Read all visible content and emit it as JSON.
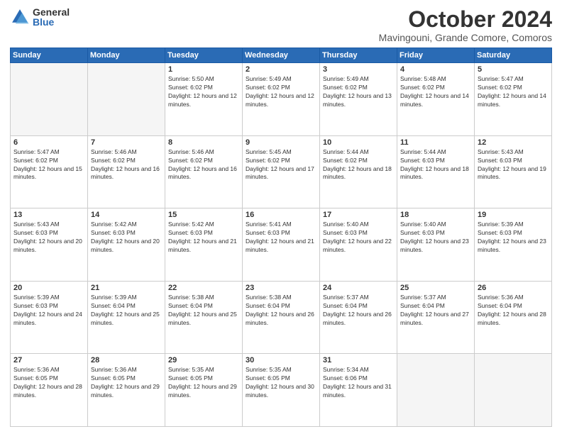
{
  "logo": {
    "general": "General",
    "blue": "Blue"
  },
  "header": {
    "month": "October 2024",
    "location": "Mavingouni, Grande Comore, Comoros"
  },
  "weekdays": [
    "Sunday",
    "Monday",
    "Tuesday",
    "Wednesday",
    "Thursday",
    "Friday",
    "Saturday"
  ],
  "weeks": [
    [
      {
        "day": "",
        "info": ""
      },
      {
        "day": "",
        "info": ""
      },
      {
        "day": "1",
        "info": "Sunrise: 5:50 AM\nSunset: 6:02 PM\nDaylight: 12 hours and 12 minutes."
      },
      {
        "day": "2",
        "info": "Sunrise: 5:49 AM\nSunset: 6:02 PM\nDaylight: 12 hours and 12 minutes."
      },
      {
        "day": "3",
        "info": "Sunrise: 5:49 AM\nSunset: 6:02 PM\nDaylight: 12 hours and 13 minutes."
      },
      {
        "day": "4",
        "info": "Sunrise: 5:48 AM\nSunset: 6:02 PM\nDaylight: 12 hours and 14 minutes."
      },
      {
        "day": "5",
        "info": "Sunrise: 5:47 AM\nSunset: 6:02 PM\nDaylight: 12 hours and 14 minutes."
      }
    ],
    [
      {
        "day": "6",
        "info": "Sunrise: 5:47 AM\nSunset: 6:02 PM\nDaylight: 12 hours and 15 minutes."
      },
      {
        "day": "7",
        "info": "Sunrise: 5:46 AM\nSunset: 6:02 PM\nDaylight: 12 hours and 16 minutes."
      },
      {
        "day": "8",
        "info": "Sunrise: 5:46 AM\nSunset: 6:02 PM\nDaylight: 12 hours and 16 minutes."
      },
      {
        "day": "9",
        "info": "Sunrise: 5:45 AM\nSunset: 6:02 PM\nDaylight: 12 hours and 17 minutes."
      },
      {
        "day": "10",
        "info": "Sunrise: 5:44 AM\nSunset: 6:02 PM\nDaylight: 12 hours and 18 minutes."
      },
      {
        "day": "11",
        "info": "Sunrise: 5:44 AM\nSunset: 6:03 PM\nDaylight: 12 hours and 18 minutes."
      },
      {
        "day": "12",
        "info": "Sunrise: 5:43 AM\nSunset: 6:03 PM\nDaylight: 12 hours and 19 minutes."
      }
    ],
    [
      {
        "day": "13",
        "info": "Sunrise: 5:43 AM\nSunset: 6:03 PM\nDaylight: 12 hours and 20 minutes."
      },
      {
        "day": "14",
        "info": "Sunrise: 5:42 AM\nSunset: 6:03 PM\nDaylight: 12 hours and 20 minutes."
      },
      {
        "day": "15",
        "info": "Sunrise: 5:42 AM\nSunset: 6:03 PM\nDaylight: 12 hours and 21 minutes."
      },
      {
        "day": "16",
        "info": "Sunrise: 5:41 AM\nSunset: 6:03 PM\nDaylight: 12 hours and 21 minutes."
      },
      {
        "day": "17",
        "info": "Sunrise: 5:40 AM\nSunset: 6:03 PM\nDaylight: 12 hours and 22 minutes."
      },
      {
        "day": "18",
        "info": "Sunrise: 5:40 AM\nSunset: 6:03 PM\nDaylight: 12 hours and 23 minutes."
      },
      {
        "day": "19",
        "info": "Sunrise: 5:39 AM\nSunset: 6:03 PM\nDaylight: 12 hours and 23 minutes."
      }
    ],
    [
      {
        "day": "20",
        "info": "Sunrise: 5:39 AM\nSunset: 6:03 PM\nDaylight: 12 hours and 24 minutes."
      },
      {
        "day": "21",
        "info": "Sunrise: 5:39 AM\nSunset: 6:04 PM\nDaylight: 12 hours and 25 minutes."
      },
      {
        "day": "22",
        "info": "Sunrise: 5:38 AM\nSunset: 6:04 PM\nDaylight: 12 hours and 25 minutes."
      },
      {
        "day": "23",
        "info": "Sunrise: 5:38 AM\nSunset: 6:04 PM\nDaylight: 12 hours and 26 minutes."
      },
      {
        "day": "24",
        "info": "Sunrise: 5:37 AM\nSunset: 6:04 PM\nDaylight: 12 hours and 26 minutes."
      },
      {
        "day": "25",
        "info": "Sunrise: 5:37 AM\nSunset: 6:04 PM\nDaylight: 12 hours and 27 minutes."
      },
      {
        "day": "26",
        "info": "Sunrise: 5:36 AM\nSunset: 6:04 PM\nDaylight: 12 hours and 28 minutes."
      }
    ],
    [
      {
        "day": "27",
        "info": "Sunrise: 5:36 AM\nSunset: 6:05 PM\nDaylight: 12 hours and 28 minutes."
      },
      {
        "day": "28",
        "info": "Sunrise: 5:36 AM\nSunset: 6:05 PM\nDaylight: 12 hours and 29 minutes."
      },
      {
        "day": "29",
        "info": "Sunrise: 5:35 AM\nSunset: 6:05 PM\nDaylight: 12 hours and 29 minutes."
      },
      {
        "day": "30",
        "info": "Sunrise: 5:35 AM\nSunset: 6:05 PM\nDaylight: 12 hours and 30 minutes."
      },
      {
        "day": "31",
        "info": "Sunrise: 5:34 AM\nSunset: 6:06 PM\nDaylight: 12 hours and 31 minutes."
      },
      {
        "day": "",
        "info": ""
      },
      {
        "day": "",
        "info": ""
      }
    ]
  ]
}
